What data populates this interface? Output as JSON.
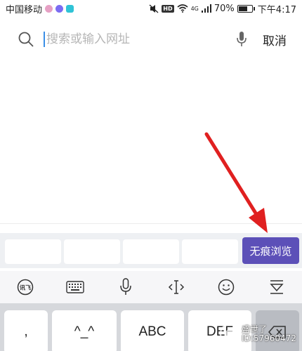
{
  "status_bar": {
    "carrier": "中国移动",
    "network": "4G",
    "battery": "70%",
    "battery_fraction": 0.7,
    "time": "下午4:17",
    "app_icon_colors": [
      "#e6a0c4",
      "#7b6cf2",
      "#2fc3d6"
    ]
  },
  "search": {
    "placeholder": "搜索或输入网址",
    "cancel_label": "取消",
    "search_icon": "search-icon",
    "mic_icon": "microphone-icon"
  },
  "suggestions": {
    "incognito_label": "无痕浏览",
    "accent_color": "#5c50b8"
  },
  "keyboard_toolbar": {
    "icons": [
      "ifly-logo-icon",
      "keyboard-icon",
      "microphone-icon",
      "cursor-move-icon",
      "emoji-icon",
      "collapse-keyboard-icon"
    ]
  },
  "keyboard": {
    "keys": [
      ",",
      "^_^",
      "ABC",
      "DEF",
      ""
    ]
  },
  "annotation": {
    "arrow_color": "#e02020"
  },
  "watermark": {
    "line1": "盛世了",
    "line2": "ID:57960472"
  }
}
